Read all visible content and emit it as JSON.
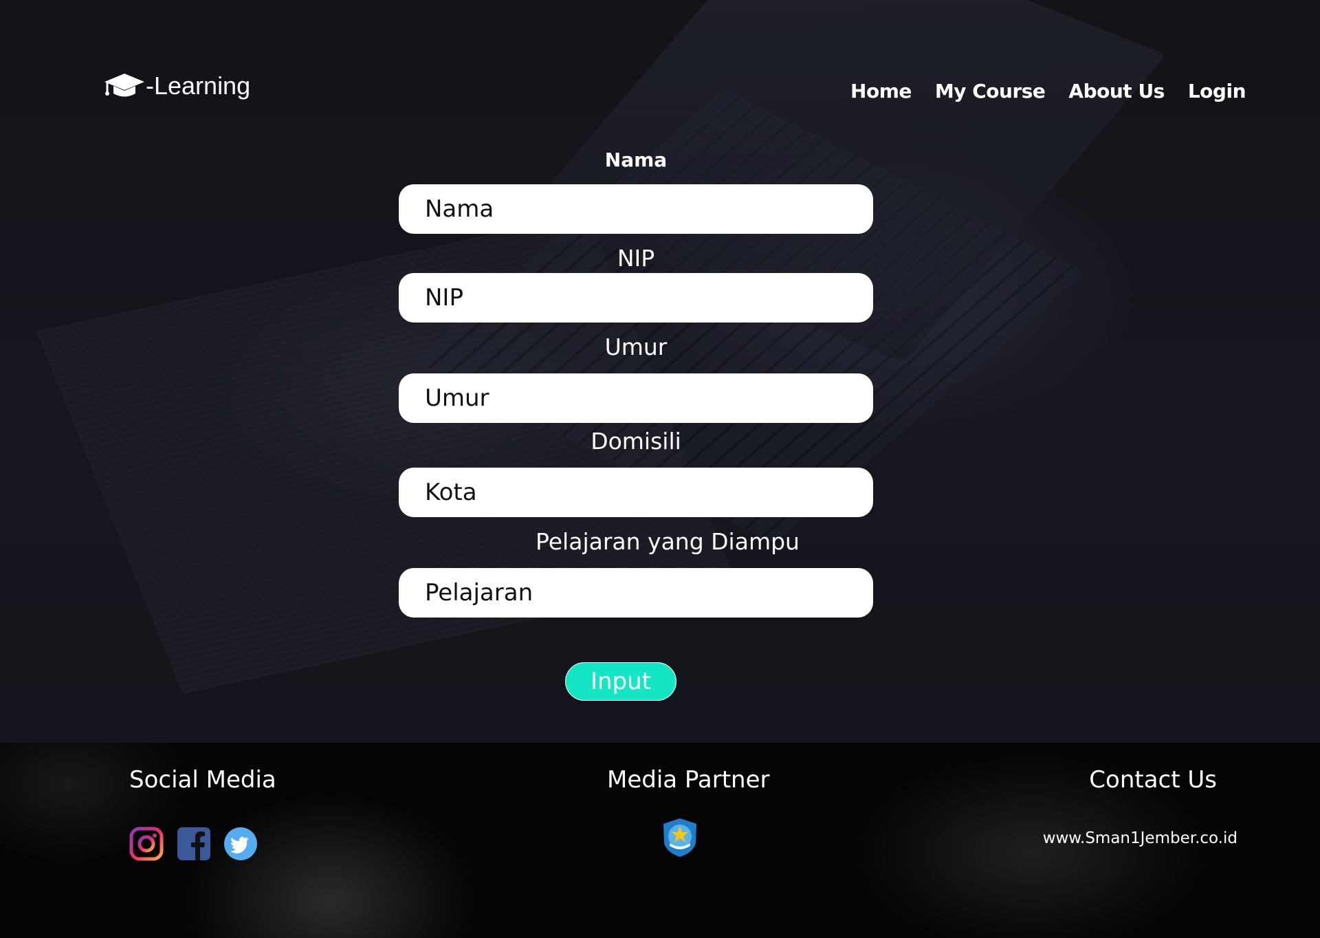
{
  "brand": {
    "logo_text": "-Learning",
    "logo_icon": "graduation-cap-icon"
  },
  "nav": {
    "home": "Home",
    "my_course": "My Course",
    "about_us": "About Us",
    "login": "Login"
  },
  "form": {
    "nama_label": "Nama",
    "nama_placeholder": "Nama",
    "nip_label": "NIP",
    "nip_placeholder": "NIP",
    "umur_label": "Umur",
    "umur_placeholder": "Umur",
    "domisili_label": "Domisili",
    "domisili_placeholder": "Kota",
    "pelajaran_label": "Pelajaran yang Diampu",
    "pelajaran_placeholder": "Pelajaran",
    "submit_label": "Input"
  },
  "footer": {
    "social_title": "Social Media",
    "social_icons": [
      "instagram-icon",
      "facebook-icon",
      "twitter-icon"
    ],
    "partner_title": "Media Partner",
    "partner_icon": "kemendikbud-logo",
    "contact_title": "Contact Us",
    "contact_url": "www.Sman1Jember.co.id"
  },
  "colors": {
    "accent": "#14e5c4",
    "field_background": "#ffffff",
    "footer_background": "#050505",
    "facebook": "#3b5998",
    "twitter": "#1da1f2"
  }
}
